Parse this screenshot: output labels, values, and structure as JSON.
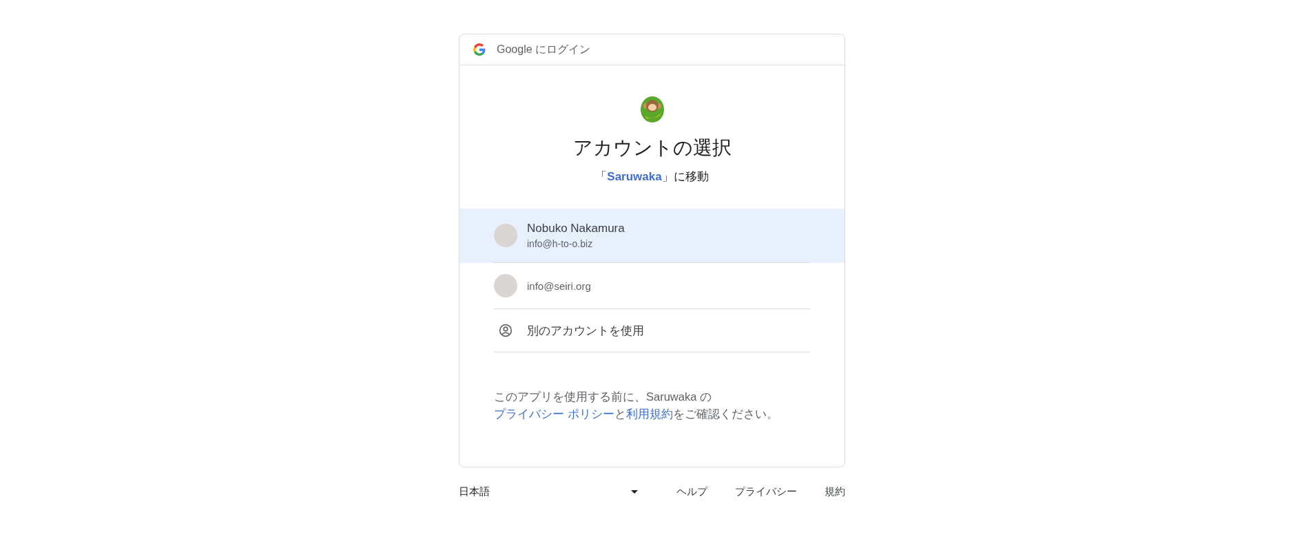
{
  "header": {
    "title": "Google にログイン"
  },
  "title": "アカウントの選択",
  "subtitle": {
    "before": "「",
    "app": "Saruwaka",
    "after": "」に移動"
  },
  "accounts": [
    {
      "kind": "account",
      "name": "Nobuko Nakamura",
      "email": "info@h-to-o.biz",
      "selected": true
    },
    {
      "kind": "account",
      "email": "info@seiri.org",
      "selected": false
    },
    {
      "kind": "other",
      "label": "別のアカウントを使用",
      "selected": false
    }
  ],
  "notice": [
    [
      {
        "kind": "text",
        "text": "このアプリを使用する前に、Saruwaka の"
      }
    ],
    [
      {
        "kind": "link",
        "text": "プライバシー ポリシー"
      },
      {
        "kind": "text",
        "text": "と"
      },
      {
        "kind": "link",
        "text": "利用規約"
      },
      {
        "kind": "text",
        "text": "をご確認ください。"
      }
    ]
  ],
  "footer": {
    "language": "日本語",
    "links": [
      "ヘルプ",
      "プライバシー",
      "規約"
    ]
  }
}
